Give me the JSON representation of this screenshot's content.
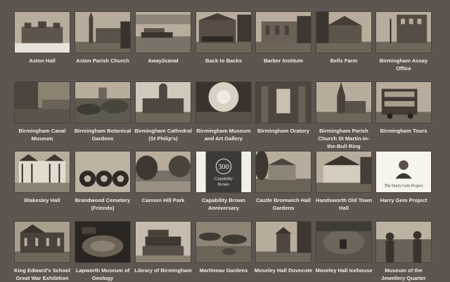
{
  "gallery": {
    "items": [
      {
        "label": "Aston Hall",
        "scene": "hall"
      },
      {
        "label": "Aston Parish Church",
        "scene": "church"
      },
      {
        "label": "Away2canal",
        "scene": "canal-boat"
      },
      {
        "label": "Back to Backs",
        "scene": "terrace"
      },
      {
        "label": "Barber Institute",
        "scene": "gallery-building"
      },
      {
        "label": "Bells Farm",
        "scene": "farmhouse"
      },
      {
        "label": "Birmingham Assay Office",
        "scene": "office-building"
      },
      {
        "label": "Birmingham Canal Museum",
        "scene": "canal"
      },
      {
        "label": "Birmingham Botanical Gardens",
        "scene": "garden"
      },
      {
        "label": "Birmingham Cathedral (St Philip's)",
        "scene": "cathedral"
      },
      {
        "label": "Birmingham Museum and Art Gallery",
        "scene": "dome"
      },
      {
        "label": "Birmingham Oratory",
        "scene": "interior"
      },
      {
        "label": "Birmingham Parish Church St Martin-in-the-Bull Ring",
        "scene": "spire-church"
      },
      {
        "label": "Birmingham Tours",
        "scene": "bus"
      },
      {
        "label": "Blakesley Hall",
        "scene": "tudor-house"
      },
      {
        "label": "Brandwood Cemetery (Friends)",
        "scene": "wreaths"
      },
      {
        "label": "Cannon Hill Park",
        "scene": "park"
      },
      {
        "label": "Capability Brown Anniversary",
        "scene": "logo-300",
        "logo_text": [
          "300",
          "Capability",
          "Brown"
        ]
      },
      {
        "label": "Castle Bromwich Hall Gardens",
        "scene": "garden-house"
      },
      {
        "label": "Handsworth Old Town Hall",
        "scene": "tudor-house-2"
      },
      {
        "label": "Harry Gem Project",
        "scene": "portrait",
        "caption": "The Harry Gem Project"
      },
      {
        "label": "King Edward's School Great War Exhibition",
        "scene": "school"
      },
      {
        "label": "Lapworth Museum of Geology",
        "scene": "fossil"
      },
      {
        "label": "Library of Birmingham",
        "scene": "library"
      },
      {
        "label": "Martineau Gardens",
        "scene": "planters"
      },
      {
        "label": "Moseley Hall Dovecote",
        "scene": "dovecote"
      },
      {
        "label": "Moseley Hall Icehouse",
        "scene": "icehouse"
      },
      {
        "label": "Museum of the Jewellery Quarter",
        "scene": "workshop"
      }
    ]
  }
}
